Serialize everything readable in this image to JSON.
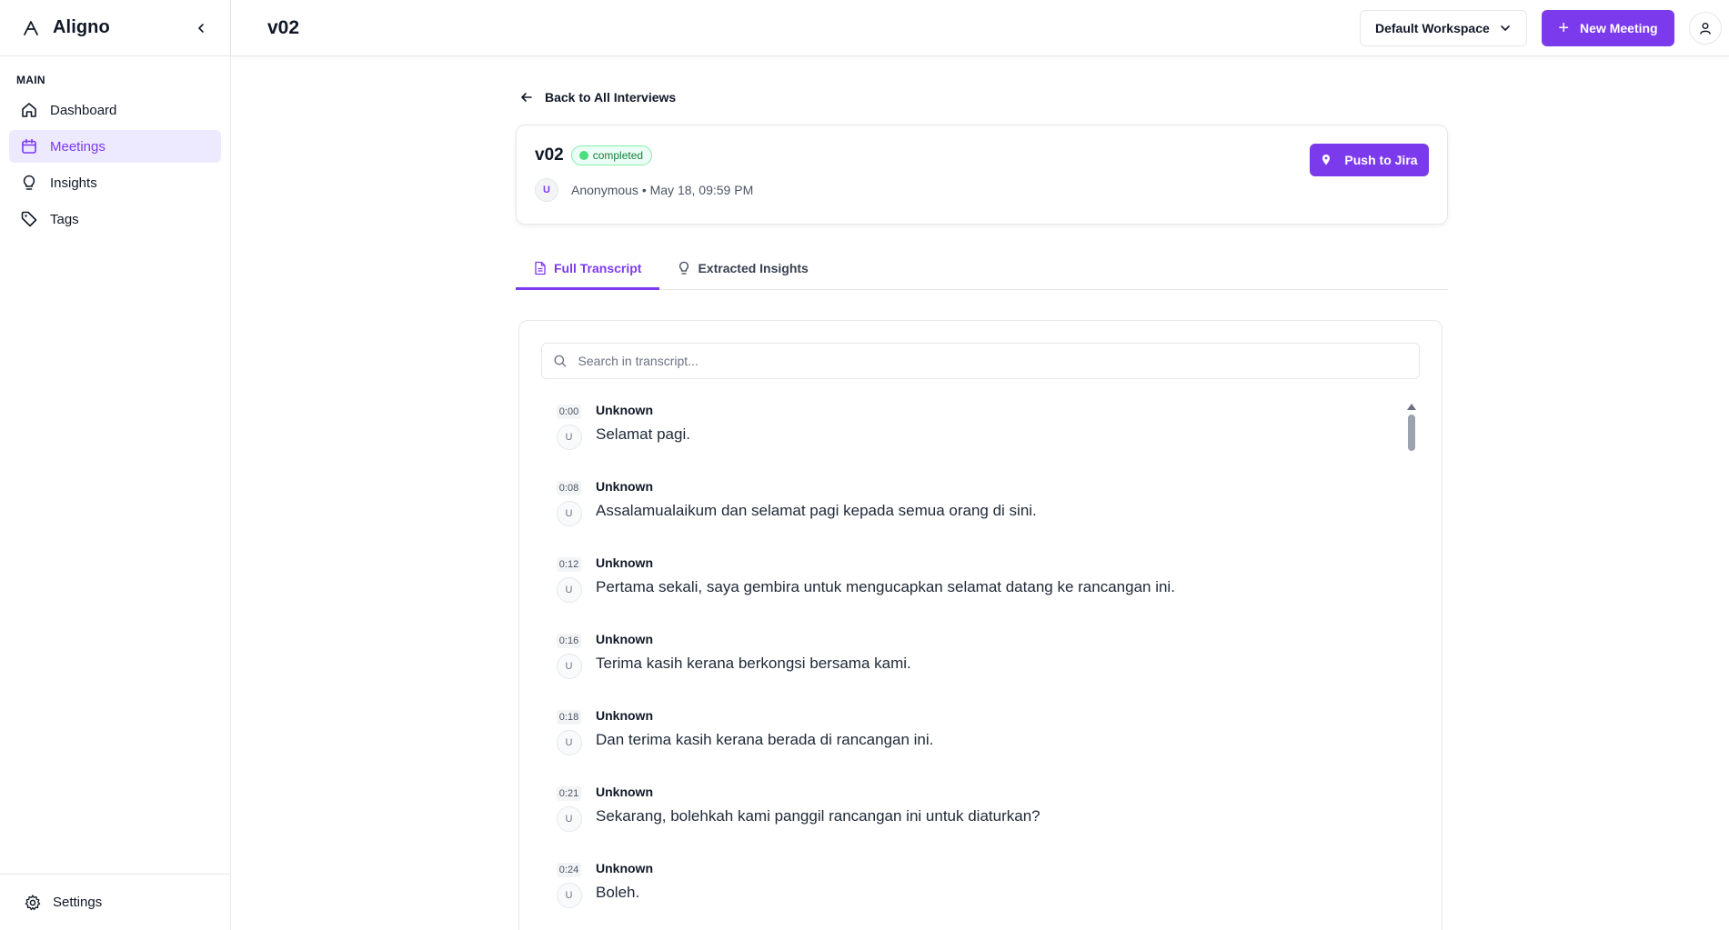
{
  "app": {
    "name": "Aligno"
  },
  "sidebar": {
    "section_label": "MAIN",
    "items": [
      {
        "label": "Dashboard",
        "icon": "home-icon",
        "active": false
      },
      {
        "label": "Meetings",
        "icon": "calendar-icon",
        "active": true
      },
      {
        "label": "Insights",
        "icon": "lightbulb-icon",
        "active": false
      },
      {
        "label": "Tags",
        "icon": "tag-icon",
        "active": false
      }
    ],
    "footer_label": "Settings"
  },
  "header": {
    "title": "v02",
    "workspace": "Default Workspace",
    "new_button": "New Meeting"
  },
  "back_link": "Back to All Interviews",
  "meeting": {
    "title": "v02",
    "status": "completed",
    "avatar_initial": "U",
    "meta": "Anonymous • May 18, 09:59 PM",
    "push_button": "Push to Jira"
  },
  "tabs": [
    {
      "label": "Full Transcript",
      "active": true
    },
    {
      "label": "Extracted Insights",
      "active": false
    }
  ],
  "search": {
    "placeholder": "Search in transcript..."
  },
  "transcript": [
    {
      "time": "0:00",
      "initial": "U",
      "speaker": "Unknown",
      "text": "Selamat pagi."
    },
    {
      "time": "0:08",
      "initial": "U",
      "speaker": "Unknown",
      "text": "Assalamualaikum dan selamat pagi kepada semua orang di sini."
    },
    {
      "time": "0:12",
      "initial": "U",
      "speaker": "Unknown",
      "text": "Pertama sekali, saya gembira untuk mengucapkan selamat datang ke rancangan ini."
    },
    {
      "time": "0:16",
      "initial": "U",
      "speaker": "Unknown",
      "text": "Terima kasih kerana berkongsi bersama kami."
    },
    {
      "time": "0:18",
      "initial": "U",
      "speaker": "Unknown",
      "text": "Dan terima kasih kerana berada di rancangan ini."
    },
    {
      "time": "0:21",
      "initial": "U",
      "speaker": "Unknown",
      "text": "Sekarang, bolehkah kami panggil rancangan ini untuk diaturkan?"
    },
    {
      "time": "0:24",
      "initial": "U",
      "speaker": "Unknown",
      "text": "Boleh."
    }
  ],
  "colors": {
    "accent": "#7c3aed",
    "accent_bg": "#ede9fe",
    "status_green": "#15803d"
  }
}
